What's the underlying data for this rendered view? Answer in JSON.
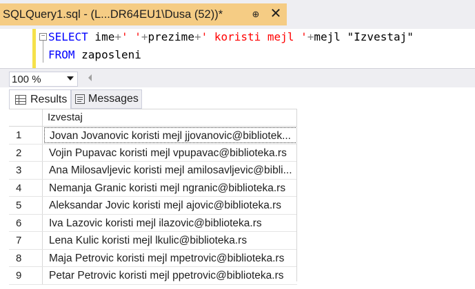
{
  "tab": {
    "title": "SQLQuery1.sql - (L...DR64EU1\\Dusa (52))*",
    "pin_icon": "pin-icon",
    "close_icon": "close-icon"
  },
  "editor": {
    "line1": {
      "kw_select": "SELECT",
      "t1": " ime",
      "op1": "+",
      "s1": "' '",
      "op2": "+",
      "t2": "prezime",
      "op3": "+",
      "s2": "' koristi mejl '",
      "op4": "+",
      "t3": "mejl \"Izvestaj\""
    },
    "line2": {
      "kw_from": "FROM",
      "t1": " zaposleni"
    },
    "collapse_glyph": "−"
  },
  "zoom": {
    "value": "100 %"
  },
  "results": {
    "tabs": [
      {
        "label": "Results",
        "icon": "grid-icon"
      },
      {
        "label": "Messages",
        "icon": "messages-icon"
      }
    ],
    "column": "Izvestaj",
    "rows": [
      {
        "num": "1",
        "value": "Jovan Jovanovic koristi mejl jjovanovic@bibliotek..."
      },
      {
        "num": "2",
        "value": "Vojin Pupavac koristi mejl vpupavac@biblioteka.rs"
      },
      {
        "num": "3",
        "value": "Ana Milosavljevic koristi mejl amilosavljevic@bibli..."
      },
      {
        "num": "4",
        "value": "Nemanja Granic koristi mejl ngranic@biblioteka.rs"
      },
      {
        "num": "5",
        "value": "Aleksandar Jovic koristi mejl ajovic@biblioteka.rs"
      },
      {
        "num": "6",
        "value": "Iva Lazovic koristi mejl ilazovic@biblioteka.rs"
      },
      {
        "num": "7",
        "value": "Lena Kulic koristi mejl lkulic@biblioteka.rs"
      },
      {
        "num": "8",
        "value": "Maja Petrovic koristi mejl mpetrovic@biblioteka.rs"
      },
      {
        "num": "9",
        "value": "Petar Petrovic koristi mejl ppetrovic@biblioteka.rs"
      }
    ]
  },
  "colors": {
    "tab_active": "#f5cc84",
    "keyword": "#0000ff",
    "string": "#ff0000",
    "operator": "#808080"
  }
}
